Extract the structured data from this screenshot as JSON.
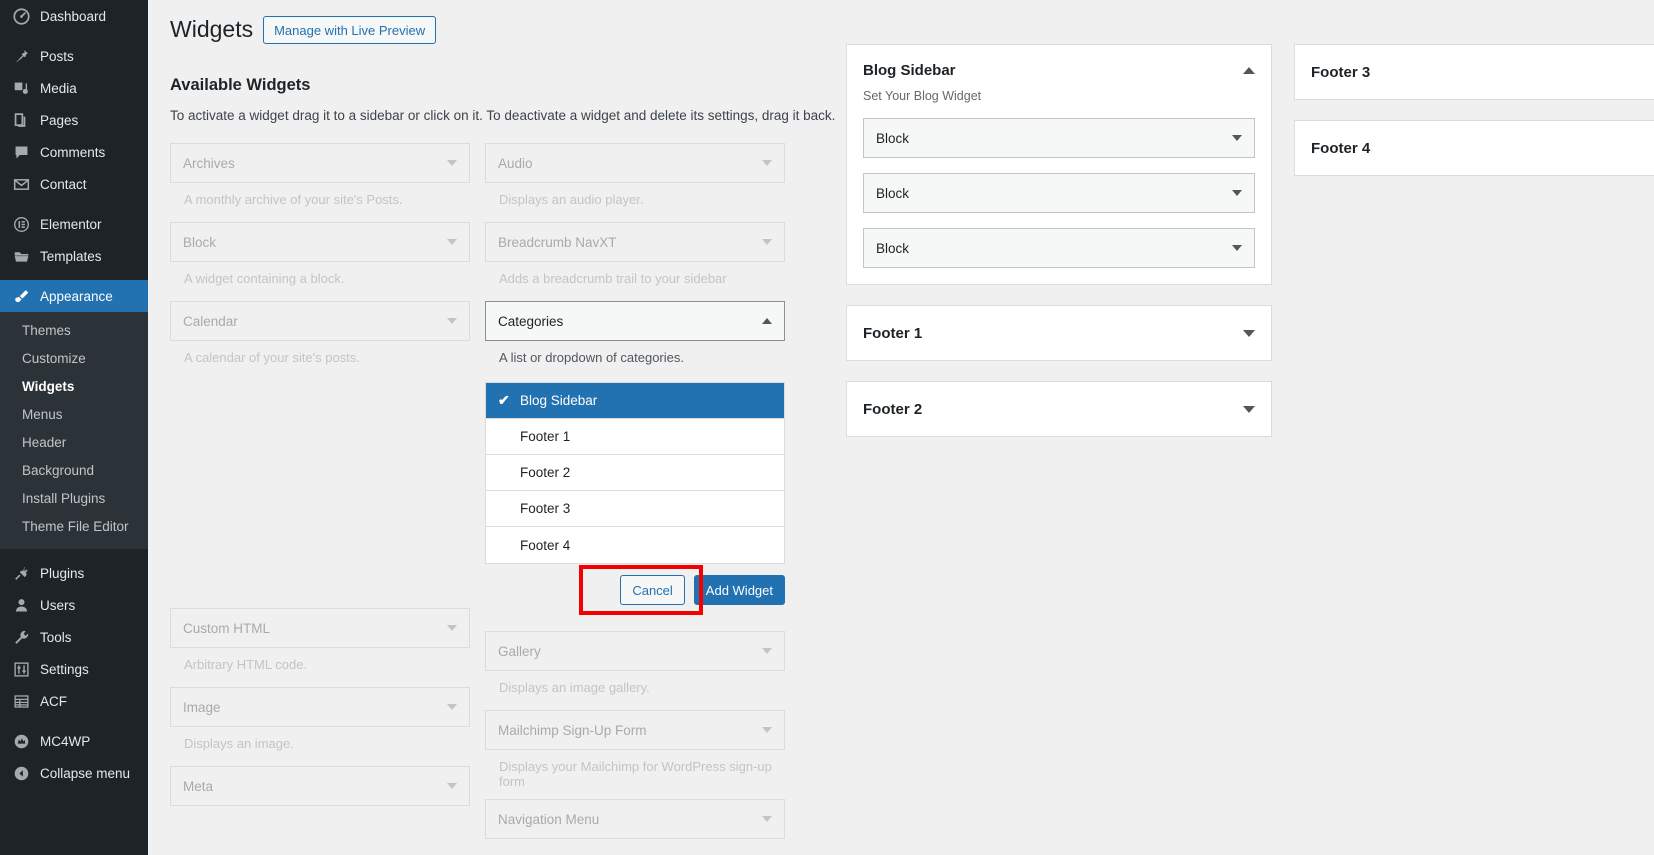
{
  "sidebar": {
    "items": [
      {
        "label": "Dashboard",
        "icon": "dashboard-icon",
        "name": "dashboard"
      },
      {
        "label": "Posts",
        "icon": "pin-icon",
        "name": "posts",
        "gap": true
      },
      {
        "label": "Media",
        "icon": "media-icon",
        "name": "media"
      },
      {
        "label": "Pages",
        "icon": "pages-icon",
        "name": "pages"
      },
      {
        "label": "Comments",
        "icon": "comments-icon",
        "name": "comments"
      },
      {
        "label": "Contact",
        "icon": "envelope-icon",
        "name": "contact"
      },
      {
        "label": "Elementor",
        "icon": "elementor-icon",
        "name": "elementor",
        "gap": true
      },
      {
        "label": "Templates",
        "icon": "folder-icon",
        "name": "templates"
      },
      {
        "label": "Appearance",
        "icon": "brush-icon",
        "name": "appearance",
        "current": true,
        "gap": true
      }
    ],
    "submenu": [
      {
        "label": "Themes",
        "name": "themes"
      },
      {
        "label": "Customize",
        "name": "customize"
      },
      {
        "label": "Widgets",
        "name": "widgets",
        "active": true
      },
      {
        "label": "Menus",
        "name": "menus"
      },
      {
        "label": "Header",
        "name": "header"
      },
      {
        "label": "Background",
        "name": "background"
      },
      {
        "label": "Install Plugins",
        "name": "install-plugins"
      },
      {
        "label": "Theme File Editor",
        "name": "theme-file-editor"
      }
    ],
    "items_after": [
      {
        "label": "Plugins",
        "icon": "plug-icon",
        "name": "plugins"
      },
      {
        "label": "Users",
        "icon": "user-icon",
        "name": "users"
      },
      {
        "label": "Tools",
        "icon": "wrench-icon",
        "name": "tools"
      },
      {
        "label": "Settings",
        "icon": "sliders-icon",
        "name": "settings"
      },
      {
        "label": "ACF",
        "icon": "table-icon",
        "name": "acf"
      },
      {
        "label": "MC4WP",
        "icon": "mailchimp-icon",
        "name": "mc4wp",
        "gap": true
      },
      {
        "label": "Collapse menu",
        "icon": "collapse-arrow-icon",
        "name": "collapse-menu"
      }
    ]
  },
  "header": {
    "title": "Widgets",
    "live_preview_label": "Manage with Live Preview"
  },
  "available": {
    "heading": "Available Widgets",
    "description": "To activate a widget drag it to a sidebar or click on it. To deactivate a widget and delete its settings, drag it back.",
    "left": [
      {
        "name": "Archives",
        "desc": "A monthly archive of your site's Posts."
      },
      {
        "name": "Block",
        "desc": "A widget containing a block."
      },
      {
        "name": "Calendar",
        "desc": "A calendar of your site's posts."
      }
    ],
    "right": [
      {
        "name": "Audio",
        "desc": "Displays an audio player."
      },
      {
        "name": "Breadcrumb NavXT",
        "desc": "Adds a breadcrumb trail to your sidebar"
      }
    ],
    "open_widget": {
      "name": "Categories",
      "desc": "A list or dropdown of categories.",
      "options": [
        {
          "label": "Blog Sidebar",
          "selected": true
        },
        {
          "label": "Footer 1",
          "selected": false
        },
        {
          "label": "Footer 2",
          "selected": false
        },
        {
          "label": "Footer 3",
          "selected": false
        },
        {
          "label": "Footer 4",
          "selected": false
        }
      ],
      "check_glyph": "✔",
      "cancel_label": "Cancel",
      "add_label": "Add Widget"
    },
    "left_bottom": [
      {
        "name": "Custom HTML",
        "desc": "Arbitrary HTML code."
      },
      {
        "name": "Image",
        "desc": "Displays an image."
      },
      {
        "name": "Meta",
        "desc": ""
      }
    ],
    "right_bottom": [
      {
        "name": "Gallery",
        "desc": "Displays an image gallery."
      },
      {
        "name": "Mailchimp Sign-Up Form",
        "desc": "Displays your Mailchimp for WordPress sign-up form"
      },
      {
        "name": "Navigation Menu",
        "desc": ""
      }
    ]
  },
  "sidebars": {
    "col1": {
      "blog_sidebar": {
        "title": "Blog Sidebar",
        "subtitle": "Set Your Blog Widget",
        "widgets": [
          {
            "label": "Block"
          },
          {
            "label": "Block"
          },
          {
            "label": "Block"
          }
        ]
      },
      "collapsed": [
        {
          "title": "Footer 1"
        },
        {
          "title": "Footer 2"
        }
      ]
    },
    "col2": [
      {
        "title": "Footer 3"
      },
      {
        "title": "Footer 4"
      }
    ]
  },
  "colors": {
    "accent": "#2271b1",
    "admin_bg": "#1d2327",
    "submenu_bg": "#2c3338",
    "highlight": "#f40000",
    "page_bg": "#f0f0f1"
  }
}
